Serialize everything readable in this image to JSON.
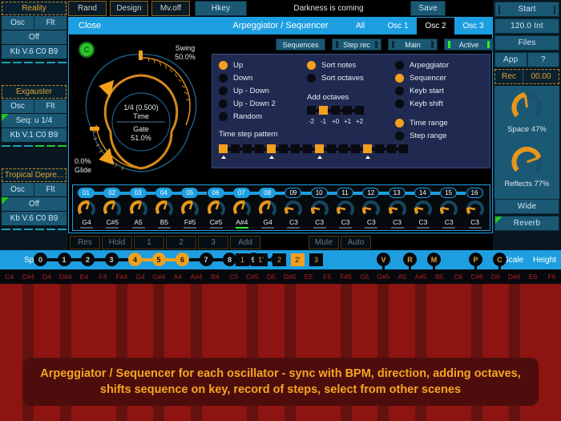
{
  "topbar": {
    "buttons": [
      "Rand",
      "Design",
      "Mv.off"
    ],
    "hkey_label": "Hkey",
    "preset_name": "Darkness is coming",
    "save_label": "Save"
  },
  "sidebar": {
    "slots": [
      {
        "name": "Reality",
        "osc": "Osc",
        "flt": "Flt",
        "mode": "Off",
        "kb": "Kb V.6 C0 B9",
        "corner": false
      },
      {
        "name": "Exgauster",
        "osc": "Osc",
        "flt": "Flt",
        "mode": "Seq: u 1/4",
        "kb": "Kb V.1 C0 B9",
        "corner": true
      },
      {
        "name": "Tropical Depre...",
        "osc": "Osc",
        "flt": "Flt",
        "mode": "Off",
        "kb": "Kb V.6 C0 B9",
        "corner": true
      }
    ]
  },
  "rightbar": {
    "start_label": "Start",
    "tempo": "120.0 Int",
    "files_label": "Files",
    "app_label": "App",
    "help_label": "?",
    "rec_label": "Rec",
    "rec_time": "00.00",
    "space_label": "Space 47%",
    "reflects_label": "Reflects 77%",
    "wide_label": "Wide",
    "reverb_label": "Reverb"
  },
  "panel": {
    "close_label": "Close",
    "title": "Arpeggiator / Sequencer",
    "tabs": [
      {
        "label": "All",
        "selected": false
      },
      {
        "label": "Osc 1",
        "selected": false
      },
      {
        "label": "Osc 2",
        "selected": true
      },
      {
        "label": "Osc 3",
        "selected": false
      }
    ],
    "toolbar": [
      {
        "label": "Sequences",
        "leds": "none"
      },
      {
        "label": "Step rec",
        "leds": "off"
      },
      {
        "label": "Main",
        "leds": "off"
      },
      {
        "label": "Active",
        "leds": "on"
      }
    ],
    "dial": {
      "key_badge": "C",
      "swing_label": "Swing",
      "swing_value": "50.0%",
      "time_value": "1/4 (0.500)",
      "time_label": "Time",
      "gate_label": "Gate",
      "gate_value": "51.0%",
      "glide_value": "0.0%",
      "glide_label": "Glide"
    },
    "direction": {
      "options": [
        "Up",
        "Down",
        "Up - Down",
        "Up - Down 2",
        "Random"
      ],
      "selected": "Up"
    },
    "sort": {
      "options": [
        "Sort notes",
        "Sort octaves"
      ],
      "selected": "Sort notes"
    },
    "add_octaves": {
      "label": "Add octaves",
      "ticks": [
        "-2",
        "-1",
        "+0",
        "+1",
        "+2"
      ],
      "selected_index": 1
    },
    "mode": {
      "options": [
        "Arpeggiator",
        "Sequencer",
        "Keyb start",
        "Keyb shift"
      ],
      "selected": "Sequencer"
    },
    "range": {
      "options": [
        "Time range",
        "Step range"
      ],
      "selected": "Time range"
    },
    "time_step_pattern": {
      "label": "Time step pattern",
      "steps": 16,
      "active_indices": [
        0,
        4,
        8,
        12
      ]
    },
    "sequencer": {
      "steps": [
        {
          "index": "01",
          "note": "G4",
          "active": true,
          "angle": -135,
          "playing": false
        },
        {
          "index": "02",
          "note": "C#5",
          "active": true,
          "angle": -35,
          "playing": false
        },
        {
          "index": "03",
          "note": "A5",
          "active": true,
          "angle": 45,
          "playing": false
        },
        {
          "index": "04",
          "note": "B5",
          "active": true,
          "angle": 15,
          "playing": false
        },
        {
          "index": "05",
          "note": "F#5",
          "active": true,
          "angle": 100,
          "playing": false
        },
        {
          "index": "06",
          "note": "C#5",
          "active": true,
          "angle": -40,
          "playing": false
        },
        {
          "index": "07",
          "note": "A#4",
          "active": true,
          "angle": -60,
          "playing": true
        },
        {
          "index": "08",
          "note": "G4",
          "active": true,
          "angle": -150,
          "playing": false
        },
        {
          "index": "09",
          "note": "C3",
          "active": false,
          "angle": 150,
          "playing": false
        },
        {
          "index": "10",
          "note": "C3",
          "active": false,
          "angle": 150,
          "playing": false
        },
        {
          "index": "11",
          "note": "C3",
          "active": false,
          "angle": 150,
          "playing": false
        },
        {
          "index": "12",
          "note": "C3",
          "active": false,
          "angle": 150,
          "playing": false
        },
        {
          "index": "13",
          "note": "C3",
          "active": false,
          "angle": 150,
          "playing": false
        },
        {
          "index": "14",
          "note": "C3",
          "active": false,
          "angle": 150,
          "playing": false
        },
        {
          "index": "15",
          "note": "C3",
          "active": false,
          "angle": 150,
          "playing": false
        },
        {
          "index": "16",
          "note": "C3",
          "active": false,
          "angle": 150,
          "playing": false
        }
      ]
    }
  },
  "bottombar": {
    "split_label": "Split",
    "octave_beads": [
      {
        "label": "0",
        "on": false
      },
      {
        "label": "1",
        "on": false
      },
      {
        "label": "2",
        "on": false
      },
      {
        "label": "3",
        "on": false
      },
      {
        "label": "4",
        "on": true
      },
      {
        "label": "5",
        "on": true
      },
      {
        "label": "6",
        "on": true
      },
      {
        "label": "7",
        "on": false
      },
      {
        "label": "8",
        "on": false
      },
      {
        "label": "9",
        "on": false
      }
    ],
    "scene_buttons": [
      {
        "label": "1",
        "on": false
      },
      {
        "label": "1'",
        "on": false
      },
      {
        "label": "2",
        "on": false
      },
      {
        "label": "2'",
        "on": true
      },
      {
        "label": "3",
        "on": false
      }
    ],
    "marker_beads": [
      "V",
      "R",
      "M",
      "P",
      "C"
    ],
    "scale_label": "Scale",
    "height_label": "Height"
  },
  "keystrip": {
    "notes": [
      "C4",
      "C#4",
      "D4",
      "D#4",
      "E4",
      "F4",
      "F#4",
      "G4",
      "G#4",
      "A4",
      "A#4",
      "B4",
      "C5",
      "C#5",
      "D5",
      "D#5",
      "E5",
      "F5",
      "F#5",
      "G5",
      "G#5",
      "A5",
      "A#5",
      "B5",
      "C6",
      "C#6",
      "D6",
      "D#6",
      "E6",
      "F6"
    ]
  },
  "caption": {
    "text": "Arpeggiator / Sequencer for each oscillator - sync with BPM, direction, adding octaves, shifts sequence on key, record of steps, select from other scenes"
  },
  "background_row": {
    "labels": [
      "Res",
      "Hold",
      "1",
      "2",
      "3",
      "Add",
      "Mute",
      "Auto"
    ]
  },
  "colors": {
    "accent_blue": "#1d9ee0",
    "accent_orange": "#f2a01e",
    "panel_blue": "#202a50",
    "teal": "#1b5874",
    "green": "#2ef02e",
    "red_key": "#b0201c"
  }
}
